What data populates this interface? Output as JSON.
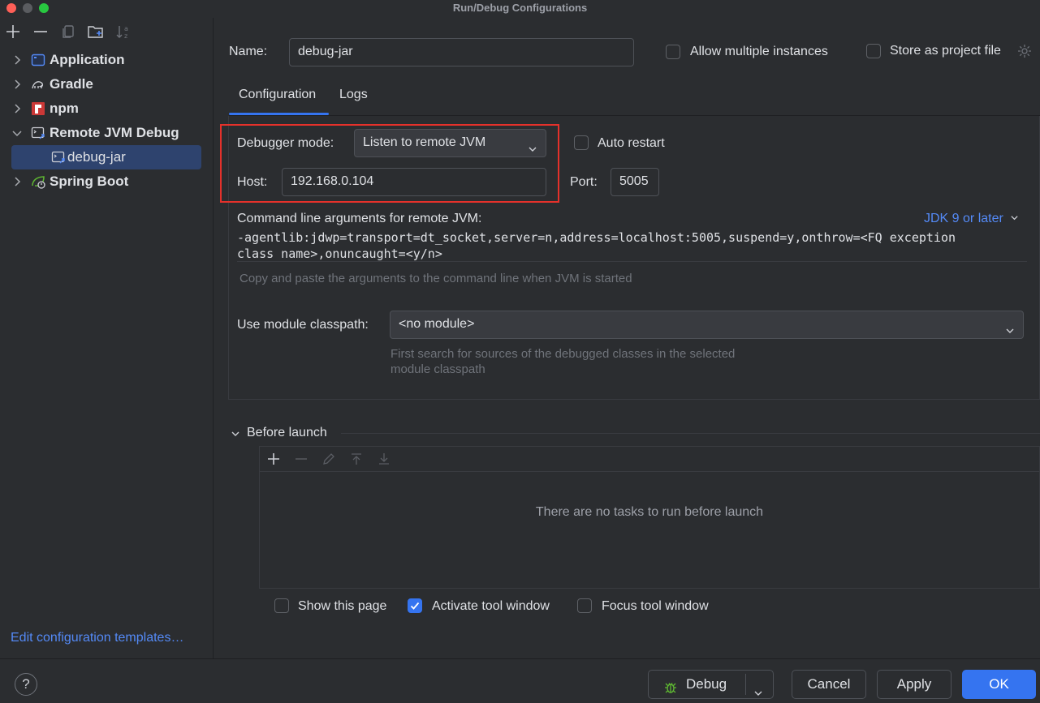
{
  "window": {
    "title": "Run/Debug Configurations"
  },
  "toolbar": {
    "icons": [
      "add-icon",
      "remove-icon",
      "copy-icon",
      "new-folder-icon",
      "sort-icon"
    ]
  },
  "tree": {
    "items": [
      {
        "label": "Application",
        "icon": "application-icon",
        "expanded": false
      },
      {
        "label": "Gradle",
        "icon": "gradle-icon",
        "expanded": false
      },
      {
        "label": "npm",
        "icon": "npm-icon",
        "expanded": false
      },
      {
        "label": "Remote JVM Debug",
        "icon": "remote-jvm-debug-icon",
        "expanded": true
      },
      {
        "label": "debug-jar",
        "icon": "debug-config-icon",
        "selected": true
      },
      {
        "label": "Spring Boot",
        "icon": "spring-boot-icon",
        "expanded": false
      }
    ],
    "edit_templates": "Edit configuration templates…"
  },
  "form": {
    "name_label": "Name:",
    "name_value": "debug-jar",
    "allow_multiple": {
      "label": "Allow multiple instances",
      "checked": false
    },
    "store_project": {
      "label": "Store as project file",
      "checked": false
    },
    "tabs": [
      "Configuration",
      "Logs"
    ],
    "debugger_mode_label": "Debugger mode:",
    "debugger_mode_value": "Listen to remote JVM",
    "auto_restart": {
      "label": "Auto restart",
      "checked": false
    },
    "host_label": "Host:",
    "host_value": "192.168.0.104",
    "port_label": "Port:",
    "port_value": "5005",
    "cmd_label": "Command line arguments for remote JVM:",
    "jdk_link": "JDK 9 or later",
    "cmd_line1": "-agentlib:jdwp=transport=dt_socket,server=n,address=localhost:5005,suspend=y,onthrow=<FQ exception",
    "cmd_line2": "class name>,onuncaught=<y/n>",
    "cmd_hint": "Copy and paste the arguments to the command line when JVM is started",
    "module_label": "Use module classpath:",
    "module_value": "<no module>",
    "module_hint1": "First search for sources of the debugged classes in the selected",
    "module_hint2": "module classpath"
  },
  "before_launch": {
    "title": "Before launch",
    "empty_text": "There are no tasks to run before launch",
    "show_page": {
      "label": "Show this page",
      "checked": false
    },
    "activate_tool": {
      "label": "Activate tool window",
      "checked": true
    },
    "focus_tool": {
      "label": "Focus tool window",
      "checked": false
    }
  },
  "footer": {
    "help": "?",
    "debug": "Debug",
    "cancel": "Cancel",
    "apply": "Apply",
    "ok": "OK"
  },
  "colors": {
    "accent": "#3574f0",
    "link": "#548af7",
    "highlight_box": "#e5312b",
    "selection": "#2e436e"
  }
}
